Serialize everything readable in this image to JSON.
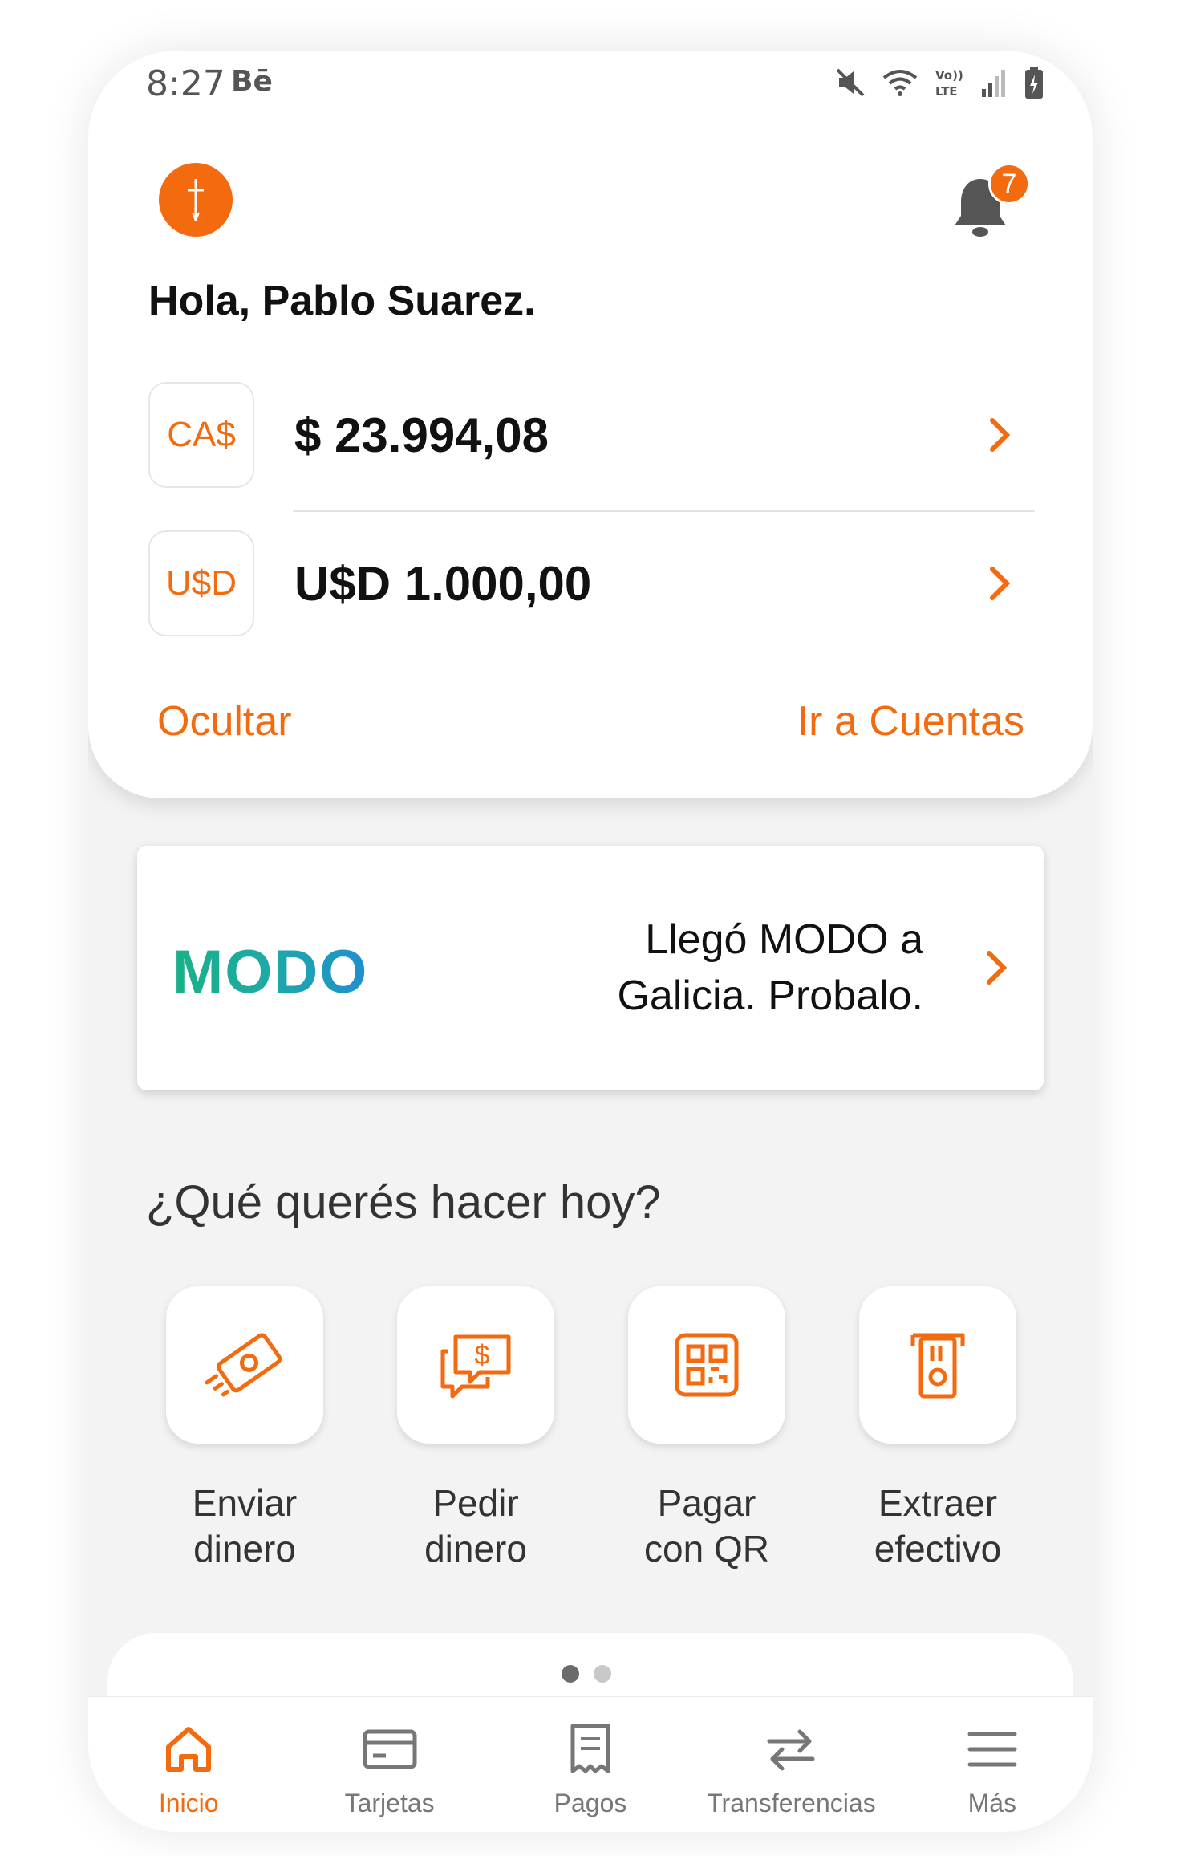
{
  "status_bar": {
    "time": "8:27",
    "carrier": "Bē"
  },
  "header": {
    "greeting": "Hola, Pablo Suarez.",
    "notification_count": "7"
  },
  "accounts": [
    {
      "currency": "CA$",
      "balance": "$ 23.994,08"
    },
    {
      "currency": "U$D",
      "balance": "U$D 1.000,00"
    }
  ],
  "links": {
    "hide": "Ocultar",
    "go_accounts": "Ir a Cuentas"
  },
  "banner": {
    "logo": "MODO",
    "line1": "Llegó MODO a",
    "line2": "Galicia. Probalo."
  },
  "quick_actions": {
    "title": "¿Qué querés hacer hoy?",
    "items": [
      {
        "line1": "Enviar",
        "line2": "dinero",
        "icon": "send-money-icon"
      },
      {
        "line1": "Pedir",
        "line2": "dinero",
        "icon": "request-money-icon"
      },
      {
        "line1": "Pagar",
        "line2": "con QR",
        "icon": "qr-pay-icon"
      },
      {
        "line1": "Extraer",
        "line2": "efectivo",
        "icon": "cash-withdraw-icon"
      }
    ]
  },
  "pager": {
    "pages": 2,
    "active": 1
  },
  "nav": [
    {
      "label": "Inicio",
      "icon": "home-icon",
      "active": true
    },
    {
      "label": "Tarjetas",
      "icon": "card-icon",
      "active": false
    },
    {
      "label": "Pagos",
      "icon": "receipt-icon",
      "active": false
    },
    {
      "label": "Transferencias",
      "icon": "transfer-icon",
      "active": false
    },
    {
      "label": "Más",
      "icon": "menu-icon",
      "active": false
    }
  ],
  "colors": {
    "accent": "#f46a0f",
    "modo_green": "#1ab187",
    "modo_blue": "#1f8fd0"
  }
}
